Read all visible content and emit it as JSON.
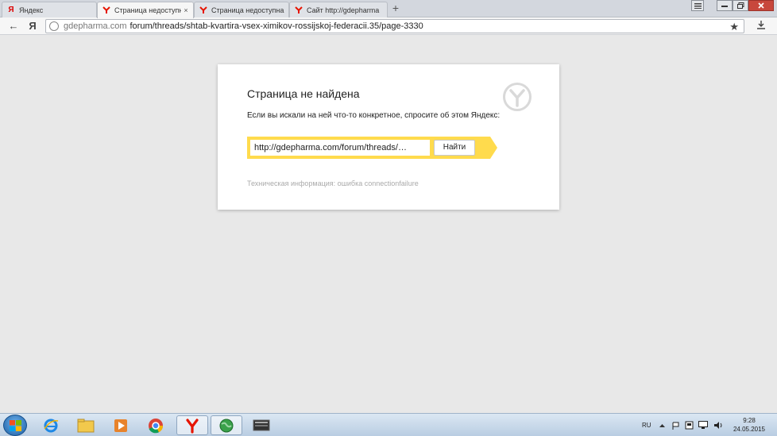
{
  "tabs": [
    {
      "label": "Яндекс",
      "favicon": "yandex-y-icon",
      "active": false
    },
    {
      "label": "Страница недоступна",
      "favicon": "yandex-browser-icon",
      "active": true
    },
    {
      "label": "Страница недоступна",
      "favicon": "yandex-browser-icon",
      "active": false
    },
    {
      "label": "Сайт http://gdepharma",
      "favicon": "yandex-browser-icon",
      "active": false
    }
  ],
  "tab_close_glyph": "×",
  "new_tab_glyph": "+",
  "address": {
    "host": "gdepharma.com",
    "path": "forum/threads/shtab-kvartira-vsex-ximikov-rossijskoj-federacii.35/page-3330"
  },
  "nav": {
    "back_glyph": "←",
    "yandex_glyph": "Я",
    "star_glyph": "★",
    "download_glyph": "⭳"
  },
  "error_page": {
    "title": "Страница не найдена",
    "text": "Если вы искали на ней что-то конкретное, спросите об этом Яндекс:",
    "search_value": "http://gdepharma.com/forum/threads/…",
    "search_button": "Найти",
    "tech_info": "Техническая информация: ошибка connectionfailure"
  },
  "taskbar": {
    "items": [
      "ie-icon",
      "file-explorer-icon",
      "media-player-icon",
      "chrome-icon",
      "yandex-browser-icon",
      "network-globe-icon",
      "terminal-icon"
    ],
    "language": "RU",
    "time": "9:28",
    "date": "24.05.2015"
  },
  "colors": {
    "accent_yellow": "#ffdb4d",
    "yandex_red": "#e61400"
  }
}
